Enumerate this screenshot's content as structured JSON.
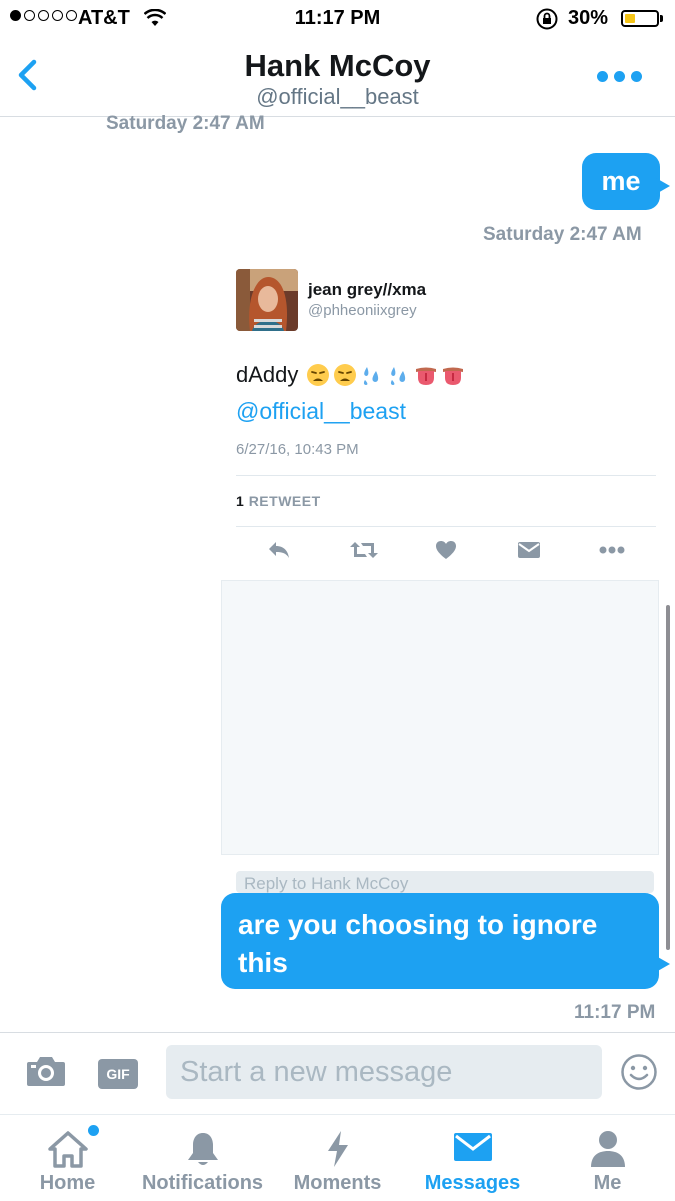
{
  "status_bar": {
    "carrier": "AT&T",
    "time": "11:17 PM",
    "battery_pct": "30%",
    "battery_level": 0.3,
    "signal_bars": 1
  },
  "header": {
    "title": "Hank McCoy",
    "subtitle": "@official__beast"
  },
  "conversation": {
    "top_timestamp": "Saturday 2:47 AM",
    "message_me": "me",
    "message_me_time": "Saturday 2:47 AM",
    "tweet": {
      "author": "jean grey//xma",
      "handle": "@phheoniixgrey",
      "text": "dAddy",
      "mention": "@official__beast",
      "date": "6/27/16, 10:43 PM",
      "retweet_count": "1",
      "retweet_label": "RETWEET",
      "reply_placeholder": "Reply to Hank McCoy"
    },
    "message_last": "are you choosing to ignore this",
    "message_last_time": "11:17 PM"
  },
  "composer": {
    "gif_label": "GIF",
    "placeholder": "Start a new message"
  },
  "tabs": [
    {
      "label": "Home",
      "icon": "home-icon"
    },
    {
      "label": "Notifications",
      "icon": "bell-icon"
    },
    {
      "label": "Moments",
      "icon": "lightning-icon"
    },
    {
      "label": "Messages",
      "icon": "envelope-icon",
      "active": true
    },
    {
      "label": "Me",
      "icon": "person-icon"
    }
  ],
  "colors": {
    "accent": "#1da1f2",
    "muted": "#8b98a5"
  }
}
